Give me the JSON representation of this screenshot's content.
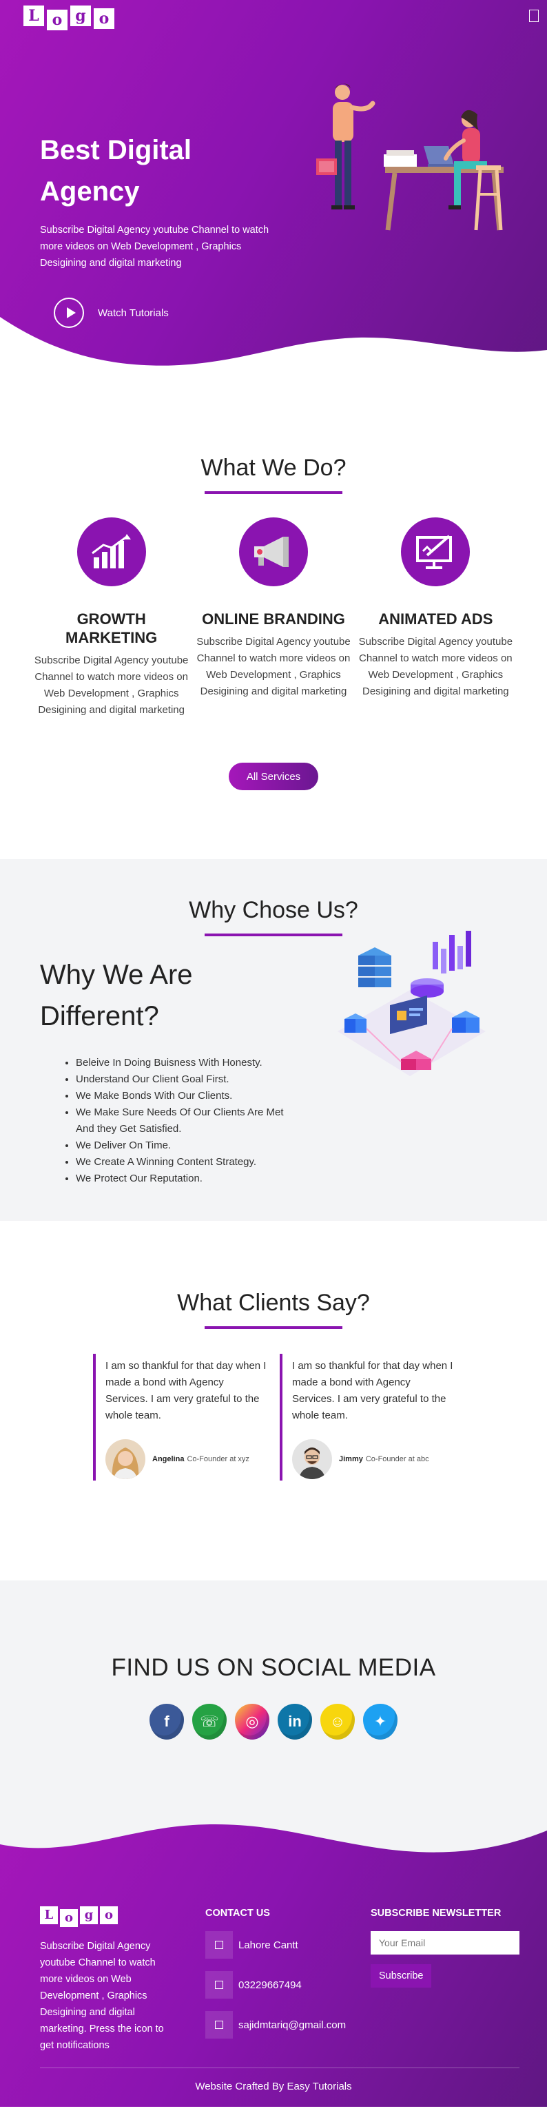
{
  "header": {
    "logo_letters": [
      "L",
      "o",
      "g",
      "o"
    ],
    "menu_icon": "menu-icon"
  },
  "hero": {
    "title_line1": "Best Digital",
    "title_line2": "Agency",
    "description": "Subscribe Digital Agency youtube Channel to watch more videos on Web Development , Graphics Desigining and digital marketing",
    "watch_label": "Watch Tutorials"
  },
  "services": {
    "title": "What We Do?",
    "items": [
      {
        "name_line1": "GROWTH",
        "name_line2": "MARKETING",
        "description": "Subscribe Digital Agency youtube Channel to watch more videos on Web Development , Graphics Desigining and digital marketing",
        "icon": "growth-chart-icon"
      },
      {
        "name_line1": "ONLINE BRANDING",
        "name_line2": "",
        "description": "Subscribe Digital Agency youtube Channel to watch more videos on Web Development , Graphics Desigining and digital marketing",
        "icon": "megaphone-icon"
      },
      {
        "name_line1": "ANIMATED ADS",
        "name_line2": "",
        "description": "Subscribe Digital Agency youtube Channel to watch more videos on Web Development , Graphics Desigining and digital marketing",
        "icon": "monitor-pen-icon"
      }
    ],
    "button_label": "All Services"
  },
  "why": {
    "title": "Why Chose Us?",
    "heading_line1": "Why We Are",
    "heading_line2": "Different?",
    "points": [
      "Beleive In Doing Buisness With Honesty.",
      "Understand Our Client Goal First.",
      "We Make Bonds With Our Clients.",
      "We Make Sure Needs Of Our Clients Are Met And they Get Satisfied.",
      "We Deliver On Time.",
      "We Create A Winning Content Strategy.",
      "We Protect Our Reputation."
    ]
  },
  "clients": {
    "title": "What Clients Say?",
    "testimonials": [
      {
        "text": "I am so thankful for that day when I made a bond with Agency Services. I am very grateful to the whole team.",
        "name": "Angelina",
        "role": "Co-Founder at xyz"
      },
      {
        "text": "I am so thankful for that day when I made a bond with Agency Services. I am very grateful to the whole team.",
        "name": "Jimmy",
        "role": "Co-Founder at abc"
      }
    ]
  },
  "social": {
    "title": "FIND US ON SOCIAL MEDIA",
    "icons": [
      {
        "name": "facebook-icon",
        "glyph": "f",
        "color": "#3b5998"
      },
      {
        "name": "whatsapp-icon",
        "glyph": "☏",
        "color": "#25a244"
      },
      {
        "name": "instagram-icon",
        "glyph": "◎",
        "color": "#c13584"
      },
      {
        "name": "linkedin-icon",
        "glyph": "in",
        "color": "#0e76a8"
      },
      {
        "name": "snapchat-icon",
        "glyph": "☺",
        "color": "#f7d60d"
      },
      {
        "name": "twitter-icon",
        "glyph": "✦",
        "color": "#1da1f2"
      }
    ]
  },
  "footer": {
    "logo_letters": [
      "L",
      "o",
      "g",
      "o"
    ],
    "about": "Subscribe Digital Agency youtube Channel to watch more videos on Web Development , Graphics Desigining and digital marketing. Press the icon to get notifications",
    "contact_heading": "CONTACT US",
    "contacts": [
      {
        "icon": "location-icon",
        "text": "Lahore Cantt"
      },
      {
        "icon": "phone-icon",
        "text": "03229667494"
      },
      {
        "icon": "email-icon",
        "text": "sajidmtariq@gmail.com"
      }
    ],
    "newsletter_heading": "SUBSCRIBE NEWSLETTER",
    "email_placeholder": "Your Email",
    "subscribe_label": "Subscribe",
    "copyright": "Website Crafted By Easy Tutorials"
  },
  "colors": {
    "brand_purple": "#8a14b0",
    "gradient_start": "#a517ba",
    "gradient_end": "#5f1782",
    "section_gray": "#f3f4f6"
  }
}
